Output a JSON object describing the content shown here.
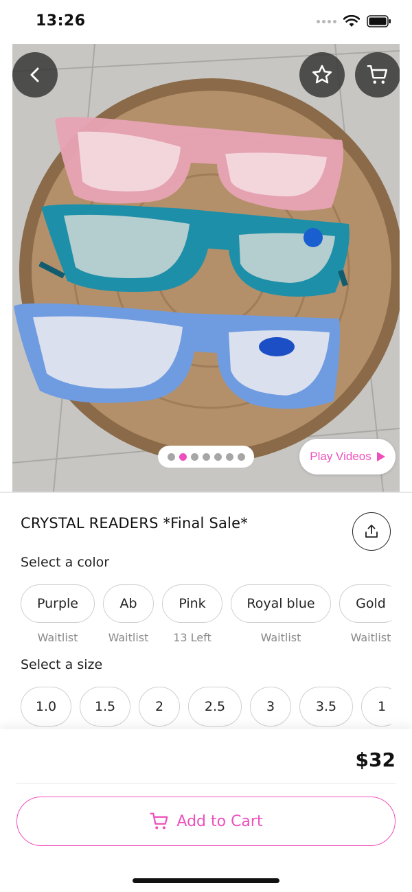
{
  "status": {
    "time": "13:26"
  },
  "product": {
    "title": "CRYSTAL READERS *Final Sale*",
    "price": "$32",
    "gallery": {
      "page_count": 7,
      "active_index": 1
    }
  },
  "actions": {
    "play_videos": "Play Videos",
    "add_to_cart": "Add to Cart"
  },
  "color_section": {
    "label": "Select a color",
    "options": [
      {
        "name": "Purple",
        "status": "Waitlist"
      },
      {
        "name": "Ab",
        "status": "Waitlist"
      },
      {
        "name": "Pink",
        "status": "13 Left"
      },
      {
        "name": "Royal blue",
        "status": "Waitlist"
      },
      {
        "name": "Gold",
        "status": "Waitlist"
      }
    ]
  },
  "size_section": {
    "label": "Select a size",
    "options": [
      "1.0",
      "1.5",
      "2",
      "2.5",
      "3",
      "3.5",
      "1"
    ]
  },
  "colors": {
    "accent": "#ee4fbd"
  },
  "icons": [
    "back-icon",
    "star-icon",
    "cart-icon",
    "share-icon",
    "wifi-icon",
    "battery-icon",
    "play-icon"
  ]
}
